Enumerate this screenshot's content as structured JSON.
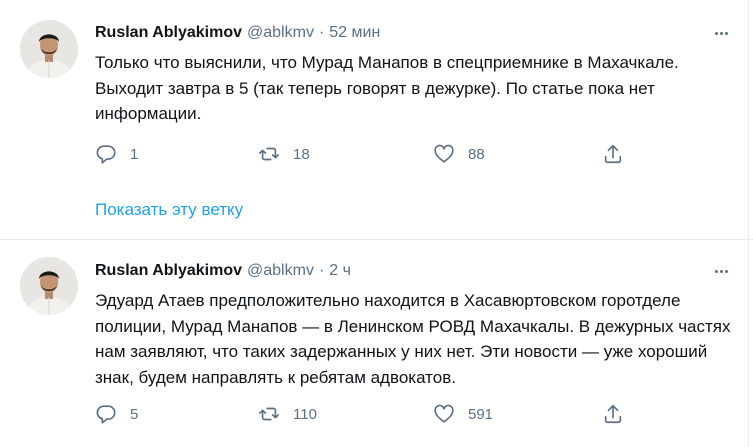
{
  "tweets": [
    {
      "author_name": "Ruslan Ablyakimov",
      "handle": "@ablkmv",
      "separator": "·",
      "time": "52 мин",
      "text": "Только что выяснили, что Мурад Манапов в спецприемнике в Махачкале. Выходит завтра в 5 (так теперь говорят в дежурке). По статье пока нет информации.",
      "replies": "1",
      "retweets": "18",
      "likes": "88",
      "show_thread_label": "Показать эту ветку"
    },
    {
      "author_name": "Ruslan Ablyakimov",
      "handle": "@ablkmv",
      "separator": "·",
      "time": "2 ч",
      "text": "Эдуард Атаев предположительно находится в Хасавюртовском горотделе полиции, Мурад Манапов — в Ленинском РОВД Махачкалы. В дежурных частях нам заявляют, что таких задержанных у них нет. Эти новости — уже хороший знак, будем направлять к ребятам адвокатов.",
      "replies": "5",
      "retweets": "110",
      "likes": "591"
    }
  ],
  "icons": {
    "reply": "reply-icon",
    "retweet": "retweet-icon",
    "like": "heart-icon",
    "share": "share-icon",
    "more": "more-icon"
  },
  "colors": {
    "text": "#0f1419",
    "secondary": "#5b7083",
    "link": "#1da1f2",
    "divider": "#e6ecf0"
  }
}
